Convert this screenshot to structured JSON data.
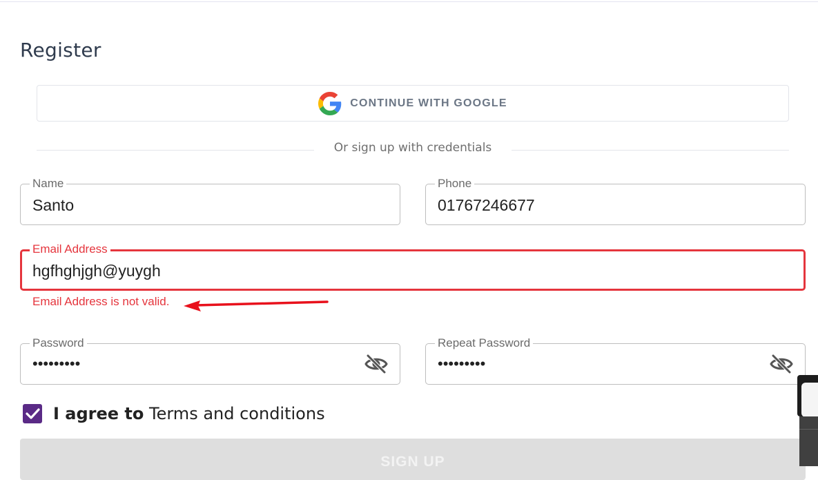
{
  "form": {
    "title": "Register",
    "google_button_label": "CONTINUE WITH GOOGLE",
    "divider_text": "Or sign up with credentials"
  },
  "fields": {
    "name": {
      "label": "Name",
      "value": "Santo"
    },
    "phone": {
      "label": "Phone",
      "value": "01767246677"
    },
    "email": {
      "label": "Email Address",
      "value": "hgfhghjgh@yuygh",
      "error": "Email Address is not valid."
    },
    "password": {
      "label": "Password",
      "masked_value": "•••••••••"
    },
    "repeat_password": {
      "label": "Repeat Password",
      "masked_value": "•••••••••"
    }
  },
  "agreement": {
    "checked": true,
    "prefix": "I agree to",
    "link_text": "Terms and conditions"
  },
  "submit": {
    "label": "SIGN UP",
    "enabled": false
  },
  "icons": {
    "google": "google-logo-icon",
    "password_toggle": "eye-off-icon",
    "checkbox": "checkmark-icon",
    "annotation": "red-arrow-icon"
  },
  "colors": {
    "error": "#e5353d",
    "checkbox": "#5a2a86",
    "title": "#2f3b4d",
    "disabled_button": "#dedede"
  }
}
